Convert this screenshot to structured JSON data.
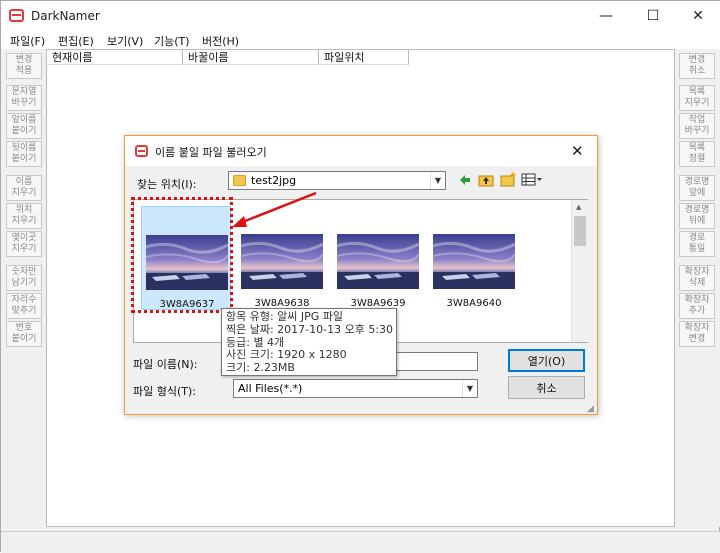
{
  "app": {
    "title": "DarkNamer",
    "brand_color": "#e23a3a",
    "minimize_glyph": "—",
    "maximize_glyph": "☐",
    "close_glyph": "✕"
  },
  "menu": [
    "파일(F)",
    "편집(E)",
    "보기(V)",
    "기능(T)",
    "버전(H)"
  ],
  "left_buttons": [
    "변경\n적용",
    "문자열\n바꾸기",
    "앞이름\n붙이기",
    "뒷이름\n붙이기",
    "이름\n지우기",
    "위치\n지우기",
    "몇이곳\n지우기",
    "숫자만\n남기기",
    "자리수\n맞추기",
    "번호\n붙이기"
  ],
  "right_buttons": [
    "변경\n취소",
    "목록\n지우기",
    "작업\n바꾸기",
    "목록\n정렬",
    "경로명\n앞에",
    "경로명\n뒤에",
    "경로\n통일",
    "확장자\n삭제",
    "확장자\n추가",
    "확장자\n변경"
  ],
  "columns": [
    "현재이름",
    "바꿀이름",
    "파일위치"
  ],
  "dialog": {
    "title": "이름 붙일 파일 불러오기",
    "look_in_label": "찾는 위치(I):",
    "look_in_value": "test2jpg",
    "files": [
      "3W8A9637",
      "3W8A9638",
      "3W8A9639",
      "3W8A9640"
    ],
    "filename_label": "파일 이름(N):",
    "filename_value": "",
    "filetype_label": "파일 형식(T):",
    "filetype_value": "All Files(*.*)",
    "open_button": "열기(O)",
    "cancel_button": "취소",
    "tooltip": [
      "항목 유형: 알씨 JPG 파일",
      "찍은 날짜: 2017-10-13 오후 5:30",
      "등급: 별 4개",
      "사진 크기: 1920 x 1280",
      "크기: 2.23MB"
    ],
    "accent_color": "#0078d7",
    "highlight_color": "#e01010"
  }
}
